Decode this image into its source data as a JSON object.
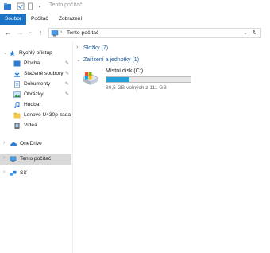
{
  "window": {
    "title": "Tento počítač"
  },
  "ribbon": {
    "tabs": [
      "Soubor",
      "Počítač",
      "Zobrazení"
    ]
  },
  "address": {
    "crumb": "Tento počítač",
    "refresh_glyph": "↻",
    "separator": "›"
  },
  "nav_glyphs": {
    "back": "←",
    "forward": "→",
    "dropdown": "⌄",
    "up": "↑",
    "expand_right": "›",
    "expand_down": "⌄"
  },
  "sidebar": {
    "quick_access": "Rychlý přístup",
    "items": [
      {
        "label": "Plocha",
        "icon": "desktop-icon",
        "pinned": true
      },
      {
        "label": "Stažené soubory",
        "icon": "download-icon",
        "pinned": true
      },
      {
        "label": "Dokumenty",
        "icon": "documents-icon",
        "pinned": true
      },
      {
        "label": "Obrázky",
        "icon": "pictures-icon",
        "pinned": true
      },
      {
        "label": "Hudba",
        "icon": "music-icon",
        "pinned": false
      },
      {
        "label": "Lenovo U430p zada",
        "icon": "folder-icon",
        "pinned": false
      },
      {
        "label": "Videa",
        "icon": "videos-icon",
        "pinned": false
      }
    ],
    "onedrive": "OneDrive",
    "this_pc": "Tento počítač",
    "network": "Síť"
  },
  "content": {
    "folders_group": "Složky (7)",
    "devices_group": "Zařízení a jednotky (1)",
    "drive": {
      "name": "Místní disk (C:)",
      "free_text": "80,5 GB volných z 111 GB",
      "used_fraction": 0.275
    }
  },
  "colors": {
    "accent": "#1a73c6",
    "drive_bar": "#26a0da",
    "selected_bg": "#d9d9d9",
    "group_text": "#1a5d9b"
  }
}
